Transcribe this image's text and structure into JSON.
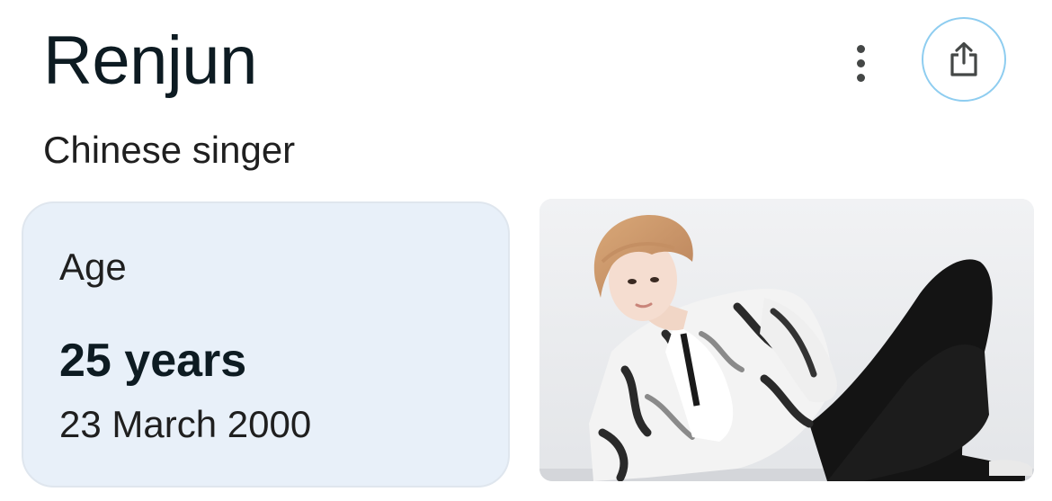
{
  "header": {
    "title": "Renjun",
    "subtitle": "Chinese singer"
  },
  "actions": {
    "more_icon": "more-vert-icon",
    "share_icon": "share-icon"
  },
  "age_card": {
    "label": "Age",
    "value": "25 years",
    "birth_date": "23 March 2000"
  },
  "photo": {
    "subject": "Renjun"
  },
  "colors": {
    "card_background": "#e8f0f9",
    "share_ring": "#8ecdf0",
    "title_text": "#0d1b22"
  }
}
